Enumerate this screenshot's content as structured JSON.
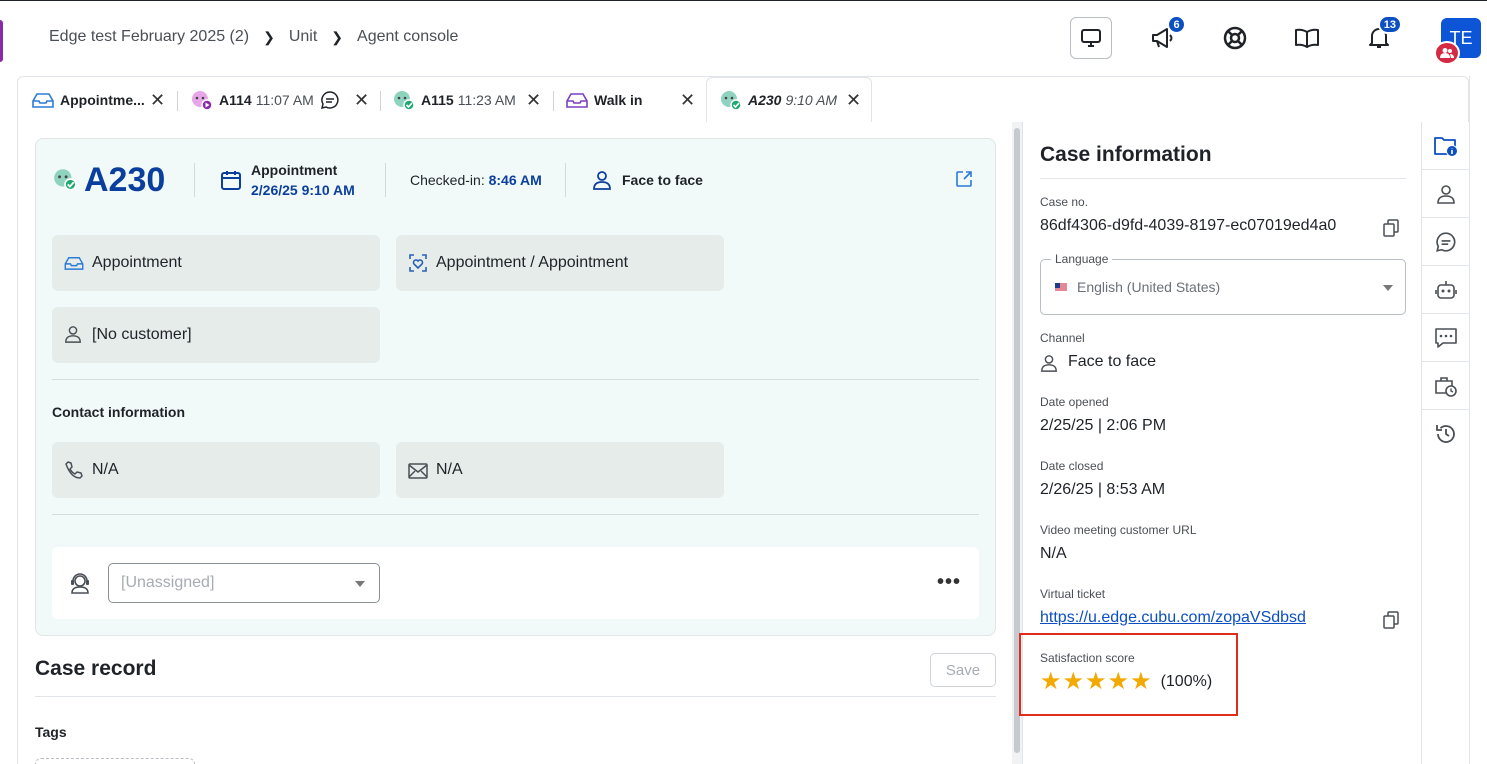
{
  "breadcrumb": {
    "items": [
      "Edge test February 2025 (2)",
      "Unit",
      "Agent console"
    ]
  },
  "header": {
    "badges": {
      "announcements": "6",
      "notifications": "13"
    },
    "avatar_initials": "TE"
  },
  "tabs": [
    {
      "label": "Appointme...",
      "time": "",
      "icon": "inbox-tray-icon"
    },
    {
      "label": "A114",
      "time": "11:07 AM",
      "icon": "pink-ticket-icon"
    },
    {
      "label": "A115",
      "time": "11:23 AM",
      "icon": "green-ticket-icon"
    },
    {
      "label": "Walk in",
      "time": "",
      "icon": "purple-inbox-icon"
    },
    {
      "label": "A230",
      "time": "9:10 AM",
      "icon": "green-ticket-icon",
      "active": true
    }
  ],
  "ticket": {
    "number": "A230",
    "appointment_label": "Appointment",
    "appointment_datetime": "2/26/25 9:10 AM",
    "checked_in_label": "Checked-in:",
    "checked_in_time": "8:46 AM",
    "channel": "Face to face",
    "service": "Appointment",
    "service_path": "Appointment / Appointment",
    "customer": "[No customer]",
    "contact_title": "Contact information",
    "phone": "N/A",
    "email": "N/A",
    "assignee_placeholder": "[Unassigned]",
    "more": "•••"
  },
  "case_record": {
    "title": "Case record",
    "save_label": "Save",
    "tags_label": "Tags"
  },
  "case_info": {
    "title": "Case information",
    "case_no_label": "Case no.",
    "case_no": "86df4306-d9fd-4039-8197-ec07019ed4a0",
    "language_label": "Language",
    "language": "English (United States)",
    "channel_label": "Channel",
    "channel": "Face to face",
    "date_opened_label": "Date opened",
    "date_opened": "2/25/25 | 2:06 PM",
    "date_closed_label": "Date closed",
    "date_closed": "2/26/25 | 8:53 AM",
    "video_url_label": "Video meeting customer URL",
    "video_url": "N/A",
    "virtual_ticket_label": "Virtual ticket",
    "virtual_ticket": "https://u.edge.cubu.com/zopaVSdbsd",
    "satisfaction_label": "Satisfaction score",
    "satisfaction_stars": 5,
    "satisfaction_pct": "(100%)"
  },
  "colors": {
    "brand_blue": "#0b3f9e",
    "accent_blue": "#0b4fc0",
    "star": "#f2a900",
    "highlight": "#e12c1d"
  }
}
